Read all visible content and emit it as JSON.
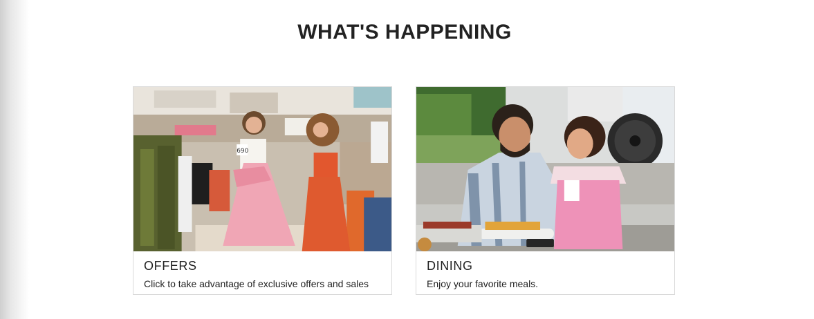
{
  "section": {
    "title": "WHAT'S HAPPENING"
  },
  "cards": [
    {
      "title": "OFFERS",
      "description": "Click to take advantage of exclusive offers and sales"
    },
    {
      "title": "DINING",
      "description": "Enjoy your favorite meals."
    }
  ]
}
